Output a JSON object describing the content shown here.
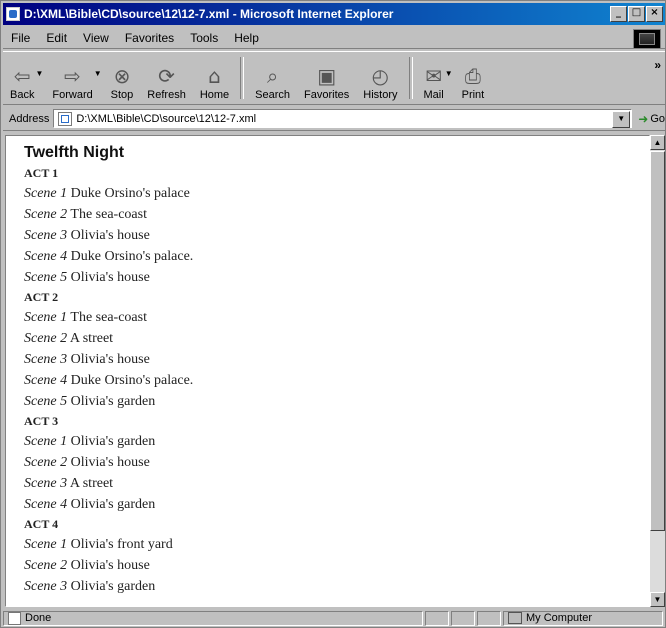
{
  "window": {
    "title": "D:\\XML\\Bible\\CD\\source\\12\\12-7.xml - Microsoft Internet Explorer",
    "min_glyph": "_",
    "max_glyph": "□",
    "close_glyph": "×"
  },
  "menu": {
    "file": "File",
    "edit": "Edit",
    "view": "View",
    "favorites": "Favorites",
    "tools": "Tools",
    "help": "Help"
  },
  "toolbar": {
    "back": "Back",
    "forward": "Forward",
    "stop": "Stop",
    "refresh": "Refresh",
    "home": "Home",
    "search": "Search",
    "favorites": "Favorites",
    "history": "History",
    "mail": "Mail",
    "print": "Print",
    "more": "»"
  },
  "address": {
    "label": "Address",
    "value": "D:\\XML\\Bible\\CD\\source\\12\\12-7.xml",
    "go": "Go"
  },
  "document": {
    "title": "Twelfth Night",
    "acts": [
      {
        "label": "ACT 1",
        "scenes": [
          {
            "num": "Scene 1",
            "place": "Duke Orsino's palace"
          },
          {
            "num": "Scene 2",
            "place": "The sea-coast"
          },
          {
            "num": "Scene 3",
            "place": "Olivia's house"
          },
          {
            "num": "Scene 4",
            "place": "Duke Orsino's palace."
          },
          {
            "num": "Scene 5",
            "place": "Olivia's house"
          }
        ]
      },
      {
        "label": "ACT 2",
        "scenes": [
          {
            "num": "Scene 1",
            "place": "The sea-coast"
          },
          {
            "num": "Scene 2",
            "place": "A street"
          },
          {
            "num": "Scene 3",
            "place": "Olivia's house"
          },
          {
            "num": "Scene 4",
            "place": "Duke Orsino's palace."
          },
          {
            "num": "Scene 5",
            "place": "Olivia's garden"
          }
        ]
      },
      {
        "label": "ACT 3",
        "scenes": [
          {
            "num": "Scene 1",
            "place": "Olivia's garden"
          },
          {
            "num": "Scene 2",
            "place": "Olivia's house"
          },
          {
            "num": "Scene 3",
            "place": "A street"
          },
          {
            "num": "Scene 4",
            "place": "Olivia's garden"
          }
        ]
      },
      {
        "label": "ACT 4",
        "scenes": [
          {
            "num": "Scene 1",
            "place": "Olivia's front yard"
          },
          {
            "num": "Scene 2",
            "place": "Olivia's house"
          },
          {
            "num": "Scene 3",
            "place": "Olivia's garden"
          }
        ]
      }
    ]
  },
  "status": {
    "text": "Done",
    "zone": "My Computer"
  }
}
